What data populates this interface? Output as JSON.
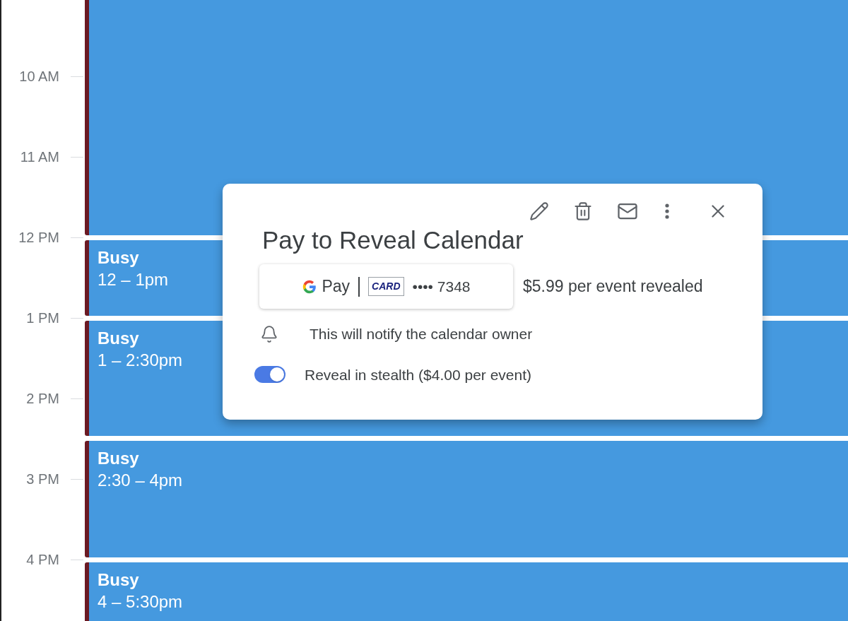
{
  "time_labels": [
    "10 AM",
    "11 AM",
    "12 PM",
    "1 PM",
    "2 PM",
    "3 PM",
    "4 PM"
  ],
  "events": [
    {
      "title": "Busy",
      "time": "12 – 1pm"
    },
    {
      "title": "Busy",
      "time": "1 – 2:30pm"
    },
    {
      "title": "Busy",
      "time": "2:30 – 4pm"
    },
    {
      "title": "Busy",
      "time": "4 – 5:30pm"
    }
  ],
  "popup": {
    "title": "Pay to Reveal Calendar",
    "payment": {
      "pay_label": "Pay",
      "card_label": "CARD",
      "card_number": "•••• 7348"
    },
    "price": "$5.99 per event revealed",
    "notice": "This will notify the calendar owner",
    "stealth": {
      "label": "Reveal in stealth ($4.00 per event)",
      "on": true
    }
  }
}
